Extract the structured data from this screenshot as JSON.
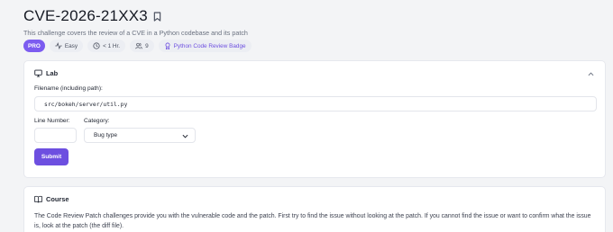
{
  "header": {
    "title": "CVE-2026-21XX3",
    "subtitle": "This challenge covers the review of a CVE in a Python codebase and its patch"
  },
  "chips": {
    "pro": "PRO",
    "difficulty": "Easy",
    "duration": "< 1 Hr.",
    "participants": "9",
    "badge": "Python Code Review Badge"
  },
  "lab": {
    "heading": "Lab",
    "filename_label": "Filename (including path):",
    "filename_value": "src/bokeh/server/util.py",
    "line_number_label": "Line Number:",
    "line_number_value": "",
    "category_label": "Category:",
    "category_selected": "Bug type",
    "submit_label": "Submit"
  },
  "course": {
    "heading": "Course",
    "text": "The Code Review Patch challenges provide you with the vulnerable code and the patch. First try to find the issue without looking at the patch. If you cannot find the issue or want to confirm what the issue is, look at the patch (the diff file)."
  },
  "colors": {
    "accent": "#6d4fe0",
    "pro_chip": "#7c5cf0",
    "page_background": "#f3f4f6"
  }
}
